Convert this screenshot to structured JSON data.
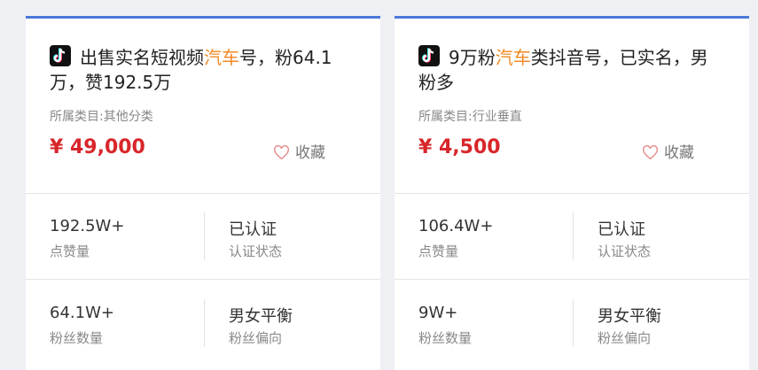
{
  "colors": {
    "accent": "#4a78d8",
    "price": "#d8262b",
    "highlight": "#f08a24"
  },
  "cards": [
    {
      "platform_icon": "tiktok-icon",
      "title_before": "出售实名短视频",
      "title_highlight": "汽车",
      "title_after": "号，粉64.1万，赞192.5万",
      "category": "所属类目:其他分类",
      "price": "¥ 49,000",
      "favorite_label": "收藏",
      "stats": [
        {
          "value": "192.5W+",
          "label": "点赞量"
        },
        {
          "value": "已认证",
          "label": "认证状态"
        },
        {
          "value": "64.1W+",
          "label": "粉丝数量"
        },
        {
          "value": "男女平衡",
          "label": "粉丝偏向"
        }
      ]
    },
    {
      "platform_icon": "tiktok-icon",
      "title_before": "9万粉",
      "title_highlight": "汽车",
      "title_after": "类抖音号，已实名，男粉多",
      "category": "所属类目:行业垂直",
      "price": "¥ 4,500",
      "favorite_label": "收藏",
      "stats": [
        {
          "value": "106.4W+",
          "label": "点赞量"
        },
        {
          "value": "已认证",
          "label": "认证状态"
        },
        {
          "value": "9W+",
          "label": "粉丝数量"
        },
        {
          "value": "男女平衡",
          "label": "粉丝偏向"
        }
      ]
    }
  ]
}
